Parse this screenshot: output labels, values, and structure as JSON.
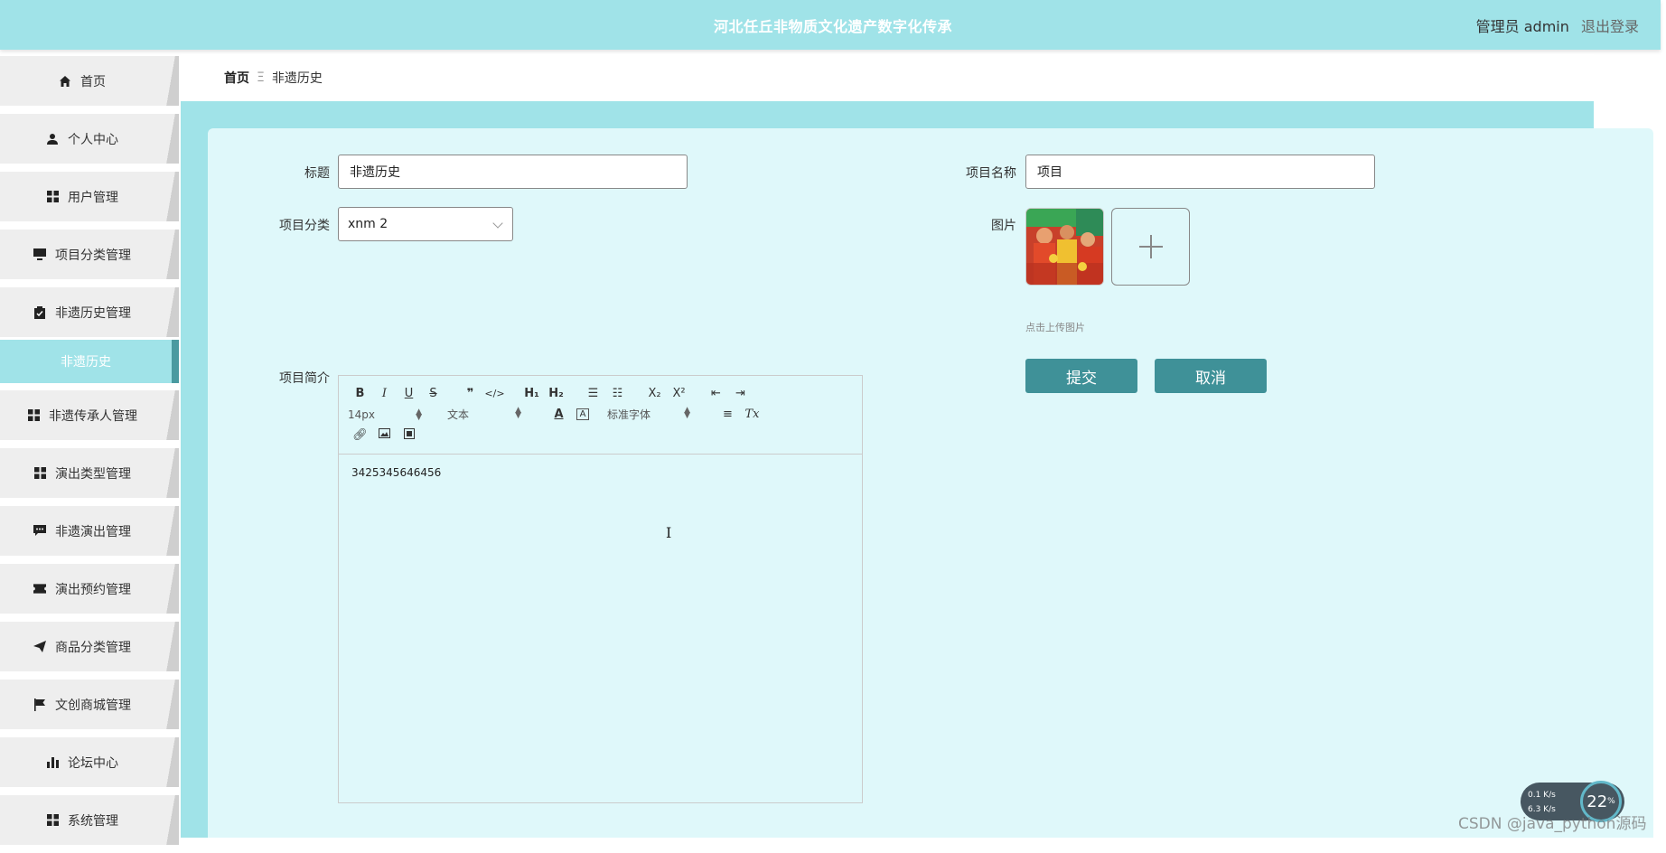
{
  "header": {
    "site_title": "河北任丘非物质文化遗产数字化传承",
    "user_label": "管理员 admin",
    "logout_label": "退出登录"
  },
  "sidebar": {
    "items": [
      {
        "label": "首页",
        "icon": "home-icon"
      },
      {
        "label": "个人中心",
        "icon": "user-icon"
      },
      {
        "label": "用户管理",
        "icon": "grid-icon"
      },
      {
        "label": "项目分类管理",
        "icon": "monitor-icon"
      },
      {
        "label": "非遗历史管理",
        "icon": "clipboard-icon"
      },
      {
        "label": "非遗历史",
        "icon": ""
      },
      {
        "label": "非遗传承人管理",
        "icon": "grid-icon"
      },
      {
        "label": "演出类型管理",
        "icon": "grid-icon"
      },
      {
        "label": "非遗演出管理",
        "icon": "chat-icon"
      },
      {
        "label": "演出预约管理",
        "icon": "ticket-icon"
      },
      {
        "label": "商品分类管理",
        "icon": "send-icon"
      },
      {
        "label": "文创商城管理",
        "icon": "flag-icon"
      },
      {
        "label": "论坛中心",
        "icon": "bar-chart-icon"
      },
      {
        "label": "系统管理",
        "icon": "grid-icon"
      }
    ]
  },
  "breadcrumb": {
    "home": "首页",
    "separator": "Ξ",
    "current": "非遗历史"
  },
  "form": {
    "title_label": "标题",
    "title_value": "非遗历史",
    "project_name_label": "项目名称",
    "project_name_value": "项目",
    "category_label": "项目分类",
    "category_value": "xnm 2",
    "image_label": "图片",
    "upload_hint": "点击上传图片",
    "intro_label": "项目简介",
    "submit_label": "提交",
    "cancel_label": "取消"
  },
  "editor": {
    "font_size": "14px",
    "block_type": "文本",
    "font_family": "标准字体",
    "content": "3425345646456"
  },
  "overlay": {
    "upload_speed": "0.1 K/s",
    "download_speed": "6.3 K/s",
    "cpu_percent": "22",
    "watermark": "CSDN @java_python源码"
  },
  "colors": {
    "accent": "#a0e3e8",
    "button": "#3f9198",
    "panel": "#dff8fa"
  }
}
